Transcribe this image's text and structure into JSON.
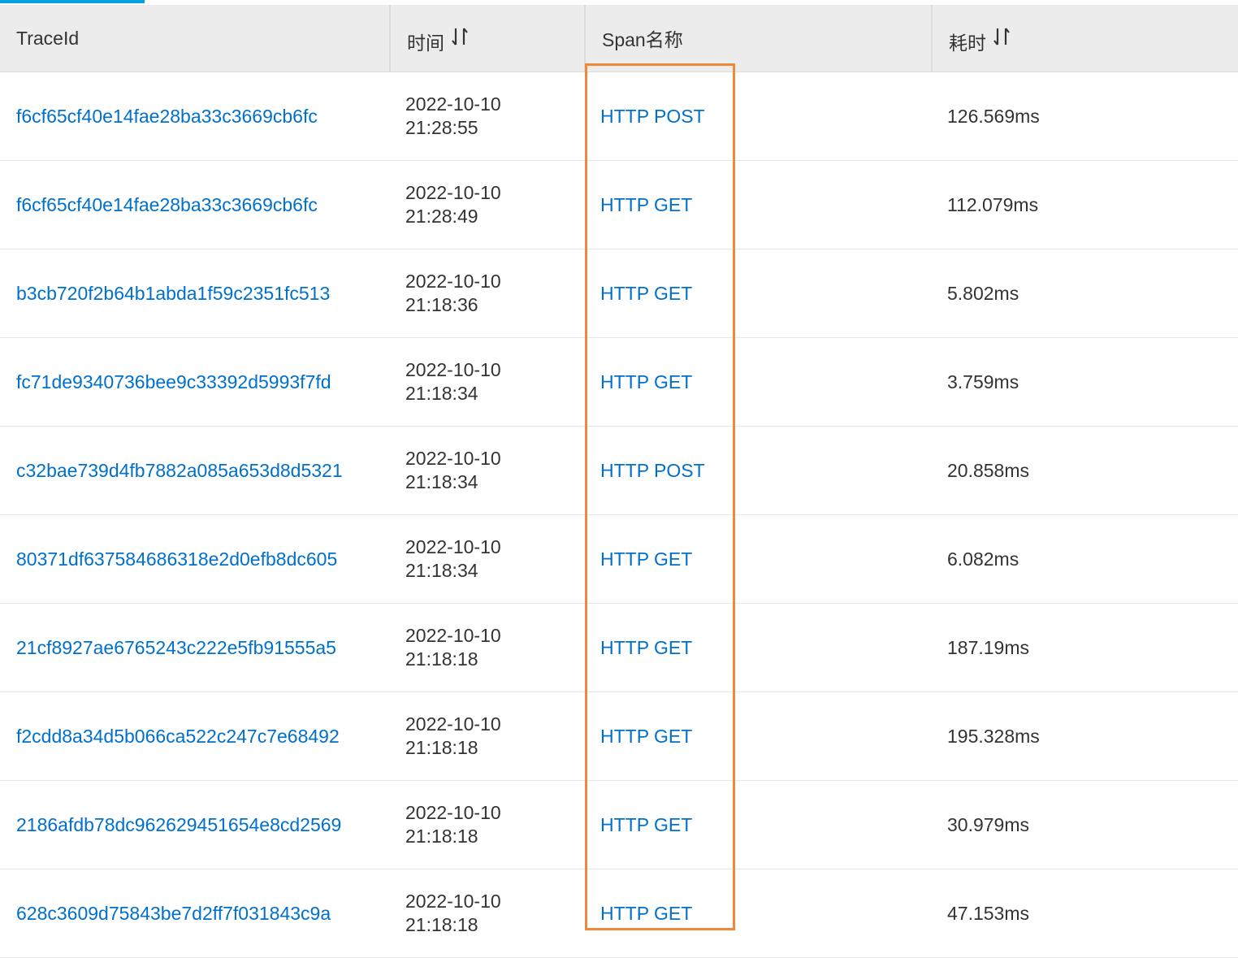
{
  "table": {
    "columns": [
      {
        "label": "TraceId",
        "sortable": false
      },
      {
        "label": "时间",
        "sortable": true
      },
      {
        "label": "Span名称",
        "sortable": false
      },
      {
        "label": "耗时",
        "sortable": true
      }
    ],
    "rows": [
      {
        "trace_id": "f6cf65cf40e14fae28ba33c3669cb6fc",
        "date": "2022-10-10",
        "time": "21:28:55",
        "span": "HTTP POST",
        "duration": "126.569ms"
      },
      {
        "trace_id": "f6cf65cf40e14fae28ba33c3669cb6fc",
        "date": "2022-10-10",
        "time": "21:28:49",
        "span": "HTTP GET",
        "duration": "112.079ms"
      },
      {
        "trace_id": "b3cb720f2b64b1abda1f59c2351fc513",
        "date": "2022-10-10",
        "time": "21:18:36",
        "span": "HTTP GET",
        "duration": "5.802ms"
      },
      {
        "trace_id": "fc71de9340736bee9c33392d5993f7fd",
        "date": "2022-10-10",
        "time": "21:18:34",
        "span": "HTTP GET",
        "duration": "3.759ms"
      },
      {
        "trace_id": "c32bae739d4fb7882a085a653d8d5321",
        "date": "2022-10-10",
        "time": "21:18:34",
        "span": "HTTP POST",
        "duration": "20.858ms"
      },
      {
        "trace_id": "80371df637584686318e2d0efb8dc605",
        "date": "2022-10-10",
        "time": "21:18:34",
        "span": "HTTP GET",
        "duration": "6.082ms"
      },
      {
        "trace_id": "21cf8927ae6765243c222e5fb91555a5",
        "date": "2022-10-10",
        "time": "21:18:18",
        "span": "HTTP GET",
        "duration": "187.19ms"
      },
      {
        "trace_id": "f2cdd8a34d5b066ca522c247c7e68492",
        "date": "2022-10-10",
        "time": "21:18:18",
        "span": "HTTP GET",
        "duration": "195.328ms"
      },
      {
        "trace_id": "2186afdb78dc962629451654e8cd2569",
        "date": "2022-10-10",
        "time": "21:18:18",
        "span": "HTTP GET",
        "duration": "30.979ms"
      },
      {
        "trace_id": "628c3609d75843be7d2ff7f031843c9a",
        "date": "2022-10-10",
        "time": "21:18:18",
        "span": "HTTP GET",
        "duration": "47.153ms"
      }
    ]
  },
  "icons": {
    "sort": "sort-icon"
  },
  "colors": {
    "link": "#0070cc",
    "header_bg": "#ececec",
    "highlight": "#f0883a",
    "accent": "#00a3e0"
  }
}
